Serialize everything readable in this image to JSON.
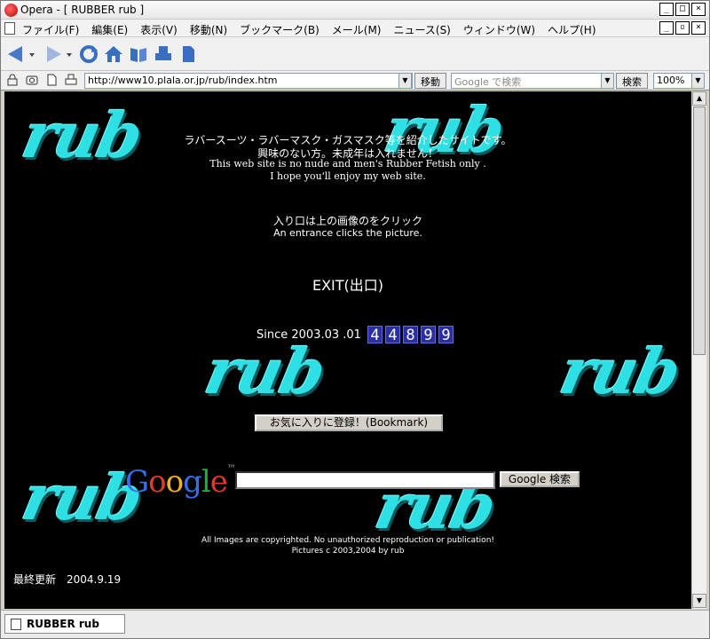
{
  "window": {
    "title": "Opera - [ RUBBER rub ]",
    "controls": {
      "minimize": "_",
      "maximize": "□",
      "close": "×"
    }
  },
  "menu": {
    "items": [
      "ファイル(F)",
      "編集(E)",
      "表示(V)",
      "移動(N)",
      "ブックマーク(B)",
      "メール(M)",
      "ニュース(S)",
      "ウィンドウ(W)",
      "ヘルプ(H)"
    ],
    "mdi_controls": {
      "minimize": "_",
      "restore": "▫",
      "close": "×"
    }
  },
  "toolbar": {
    "icons": [
      "back-icon",
      "back-dropdown-icon",
      "forward-icon",
      "forward-dropdown-icon",
      "reload-icon",
      "home-icon",
      "hotlist-icon",
      "print-icon",
      "new-page-icon"
    ]
  },
  "address": {
    "url": "http://www10.plala.or.jp/rub/index.htm",
    "go_label": "移動",
    "search_placeholder": "Google で検索",
    "search_label": "検索",
    "zoom": "100%"
  },
  "page": {
    "logo_text": "rub",
    "intro_jp_1": "ラバースーツ・ラバーマスク・ガスマスク等を紹介したサイトです。",
    "intro_jp_2": "興味のない方。未成年は入れません！",
    "intro_en_1": "This web site is no nude and men's Rubber Fetish only .",
    "intro_en_2": "I hope you'll enjoy my web site.",
    "entrance_jp": "入り口は上の画像のをクリック",
    "entrance_en": "An entrance clicks the picture.",
    "exit_link": "EXIT(出口)",
    "since": "Since 2003.03 .01",
    "counter_digits": [
      "4",
      "4",
      "8",
      "9",
      "9"
    ],
    "bookmark_button": "お気に入りに登録！(Bookmark)",
    "google_logo": "Google",
    "google_tm": "™",
    "google_button": "Google 検索",
    "copyright_1": "All Images are copyrighted. No unauthorized reproduction or publication!",
    "copyright_2": "Pictures c 2003,2004 by rub",
    "updated": "最終更新　2004.9.19"
  },
  "tab": {
    "label": "RUBBER rub"
  },
  "colors": {
    "logo": "#2ee0e4",
    "background": "#000000",
    "counter_bg": "#2a2ea0"
  }
}
